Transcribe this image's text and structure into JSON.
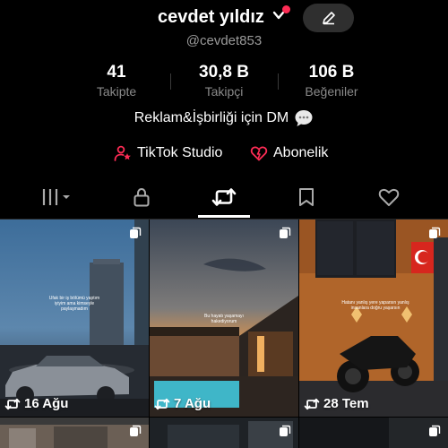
{
  "profile": {
    "username": "cevdet yıldız",
    "handle": "@cevdet853"
  },
  "stats": [
    {
      "value": "41",
      "label": "Takipte"
    },
    {
      "value": "30,8 B",
      "label": "Takipçi"
    },
    {
      "value": "106 B",
      "label": "Beğeniler"
    }
  ],
  "bio": "Reklam&İşbirliği için DM",
  "links": {
    "studio": "TikTok Studio",
    "subscription": "Abonelik"
  },
  "tabs": [
    "grid-icon",
    "lock-icon",
    "repost-icon",
    "bookmark-icon",
    "heart-icon"
  ],
  "active_tab": "repost",
  "videos": [
    {
      "date": "16 Ağu",
      "caption": "Ufak bir iş bölümü yaptım iyiyim ama kimseyle paylaşmadım"
    },
    {
      "date": "7 Ağu",
      "caption": "Bu hayatı yaşamayı hakediyorum"
    },
    {
      "date": "28 Tem",
      "caption": "Hatanı yanlış yere yaparsın yanlış insanlara doğru yaşarsın"
    },
    {
      "date": ""
    },
    {
      "date": ""
    },
    {
      "date": ""
    }
  ],
  "colors": {
    "accent": "#fe2c55",
    "bg": "#000000"
  }
}
